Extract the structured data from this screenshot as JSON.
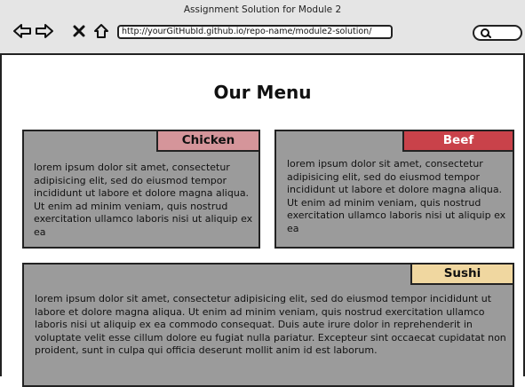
{
  "browser": {
    "window_title": "Assignment Solution for Module 2",
    "url": "http://yourGitHubId.github.io/repo-name/module2-solution/",
    "icons": [
      "back-arrow-icon",
      "forward-arrow-icon",
      "close-icon",
      "home-icon",
      "search-icon"
    ]
  },
  "page": {
    "title": "Our Menu"
  },
  "sections": {
    "chicken": {
      "label": "Chicken",
      "text": "lorem ipsum dolor sit amet, consectetur adipisicing elit, sed do eiusmod tempor incididunt ut labore et dolore magna aliqua. Ut enim ad minim veniam, quis nostrud exercitation ullamco laboris nisi ut aliquip ex ea"
    },
    "beef": {
      "label": "Beef",
      "text": "lorem ipsum dolor sit amet, consectetur adipisicing elit, sed do eiusmod tempor incididunt ut labore et dolore magna aliqua. Ut enim ad minim veniam, quis nostrud exercitation ullamco laboris nisi ut aliquip ex ea"
    },
    "sushi": {
      "label": "Sushi",
      "text": "lorem ipsum dolor sit amet, consectetur adipisicing elit, sed do eiusmod tempor incididunt ut labore et dolore magna aliqua. Ut enim ad minim veniam, quis nostrud exercitation ullamco laboris nisi ut aliquip ex ea commodo consequat. Duis aute irure dolor in reprehenderit in voluptate velit esse cillum dolore eu fugiat nulla pariatur. Excepteur sint occaecat cupidatat non proident, sunt in culpa qui officia deserunt mollit anim id est laborum."
    }
  },
  "colors": {
    "card_background": "#9b9b9b",
    "chicken_tag": "#d5959a",
    "beef_tag": "#c9424a",
    "sushi_tag": "#f0d7a0"
  }
}
